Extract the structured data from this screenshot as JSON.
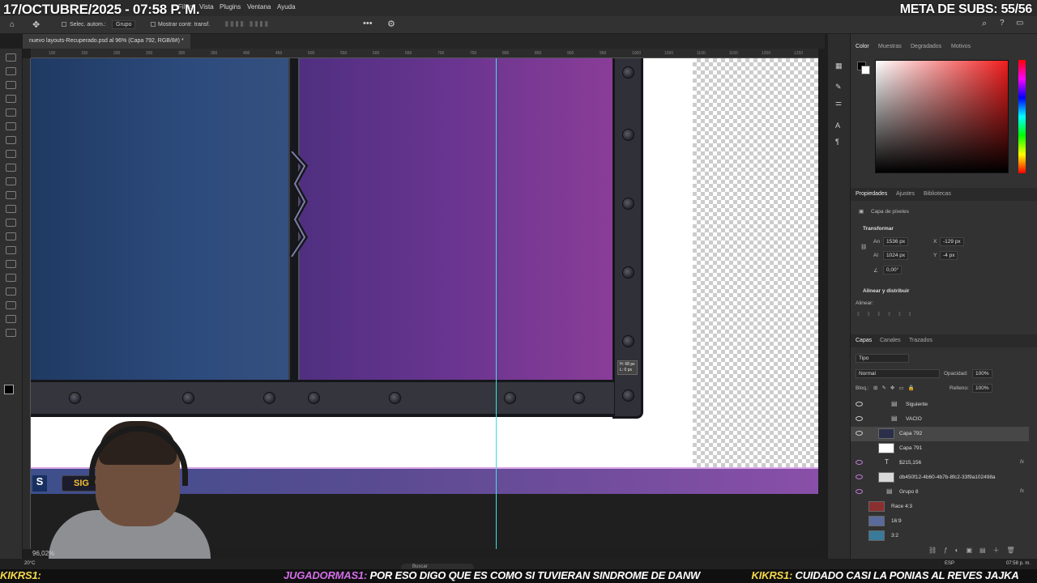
{
  "overlay": {
    "date_time": "17/OCTUBRE/2025 - 07:58 P. M.",
    "subs_goal": "META DE SUBS: 55/56"
  },
  "menubar": {
    "items": [
      "Filtro",
      "Vista",
      "Plugins",
      "Ventana",
      "Ayuda"
    ]
  },
  "options_bar": {
    "auto_select_label": "Selec. autom.:",
    "auto_select_value": "Grupo",
    "show_transform_label": "Mostrar contr. transf."
  },
  "document": {
    "tab_label": "nuevo layouts-Recuperado.psd al 96% (Capa 792, RGB/8#) *",
    "zoom": "96,02%",
    "ruler_ticks": [
      "100",
      "150",
      "200",
      "250",
      "300",
      "350",
      "400",
      "450",
      "500",
      "550",
      "600",
      "650",
      "700",
      "750",
      "800",
      "850",
      "900",
      "950",
      "1000",
      "1050",
      "1100",
      "1150",
      "1200",
      "1250",
      "1300",
      "1350"
    ],
    "measure_tooltip_w": "H: 68 px",
    "measure_tooltip_h": "L: 0 px",
    "strip_button_label": "SIGUIE",
    "strip_letter": "S"
  },
  "color_panel": {
    "tabs": [
      "Color",
      "Muestras",
      "Degradados",
      "Motivos"
    ],
    "active": "Color",
    "accent": "#f01d1d"
  },
  "properties_panel": {
    "tabs": [
      "Propiedades",
      "Ajustes",
      "Bibliotecas"
    ],
    "active": "Propiedades",
    "layer_kind": "Capa de píxeles",
    "transform_title": "Transformar",
    "width_label": "An",
    "width_value": "1536 px",
    "x_label": "X",
    "x_value": "-129 px",
    "height_label": "Al",
    "height_value": "1024 px",
    "y_label": "Y",
    "y_value": "-4 px",
    "angle_value": "0,00°",
    "align_title": "Alinear y distribuir",
    "align_label": "Alinear:"
  },
  "layers_panel": {
    "tabs": [
      "Capas",
      "Canales",
      "Trazados"
    ],
    "active": "Capas",
    "filter_label": "Tipo",
    "blend_mode": "Normal",
    "opacity_label": "Opacidad:",
    "opacity_value": "100%",
    "lock_label": "Bloq.:",
    "fill_label": "Relleno:",
    "fill_value": "100%",
    "layers": [
      {
        "name": "Siguiente",
        "type": "group",
        "visible": true
      },
      {
        "name": "VACIO",
        "type": "group",
        "visible": true
      },
      {
        "name": "Capa 792",
        "type": "pixel",
        "visible": true,
        "selected": true
      },
      {
        "name": "Capa 791",
        "type": "pixel",
        "visible": false
      },
      {
        "name": "$215,156",
        "type": "text",
        "visible": true,
        "fx": true
      },
      {
        "name": "db450f12-4b60-4b7b-8fc2-33f9a102498a",
        "type": "pixel",
        "visible": true
      },
      {
        "name": "Grupo 8",
        "type": "group",
        "visible": true,
        "fx": true
      },
      {
        "name": "Race 4:3",
        "type": "pixel",
        "visible": false
      },
      {
        "name": "16:9",
        "type": "pixel",
        "visible": false
      },
      {
        "name": "3:2",
        "type": "pixel",
        "visible": false
      }
    ]
  },
  "taskbar": {
    "weather": "20°C",
    "search_placeholder": "Buscar",
    "lang": "ESP",
    "time": "07:58 p. m."
  },
  "ticker": {
    "segments": [
      {
        "user": "KIKRS1:",
        "text": ""
      },
      {
        "user": "JUGADORMAS1:",
        "text": " POR ESO DIGO QUE ES COMO SI TUVIERAN SINDROME DE DANW "
      },
      {
        "user": "KIKRS1:",
        "text": " CUIDADO CASI LA PONIAS AL REVES JAJKA"
      }
    ]
  }
}
